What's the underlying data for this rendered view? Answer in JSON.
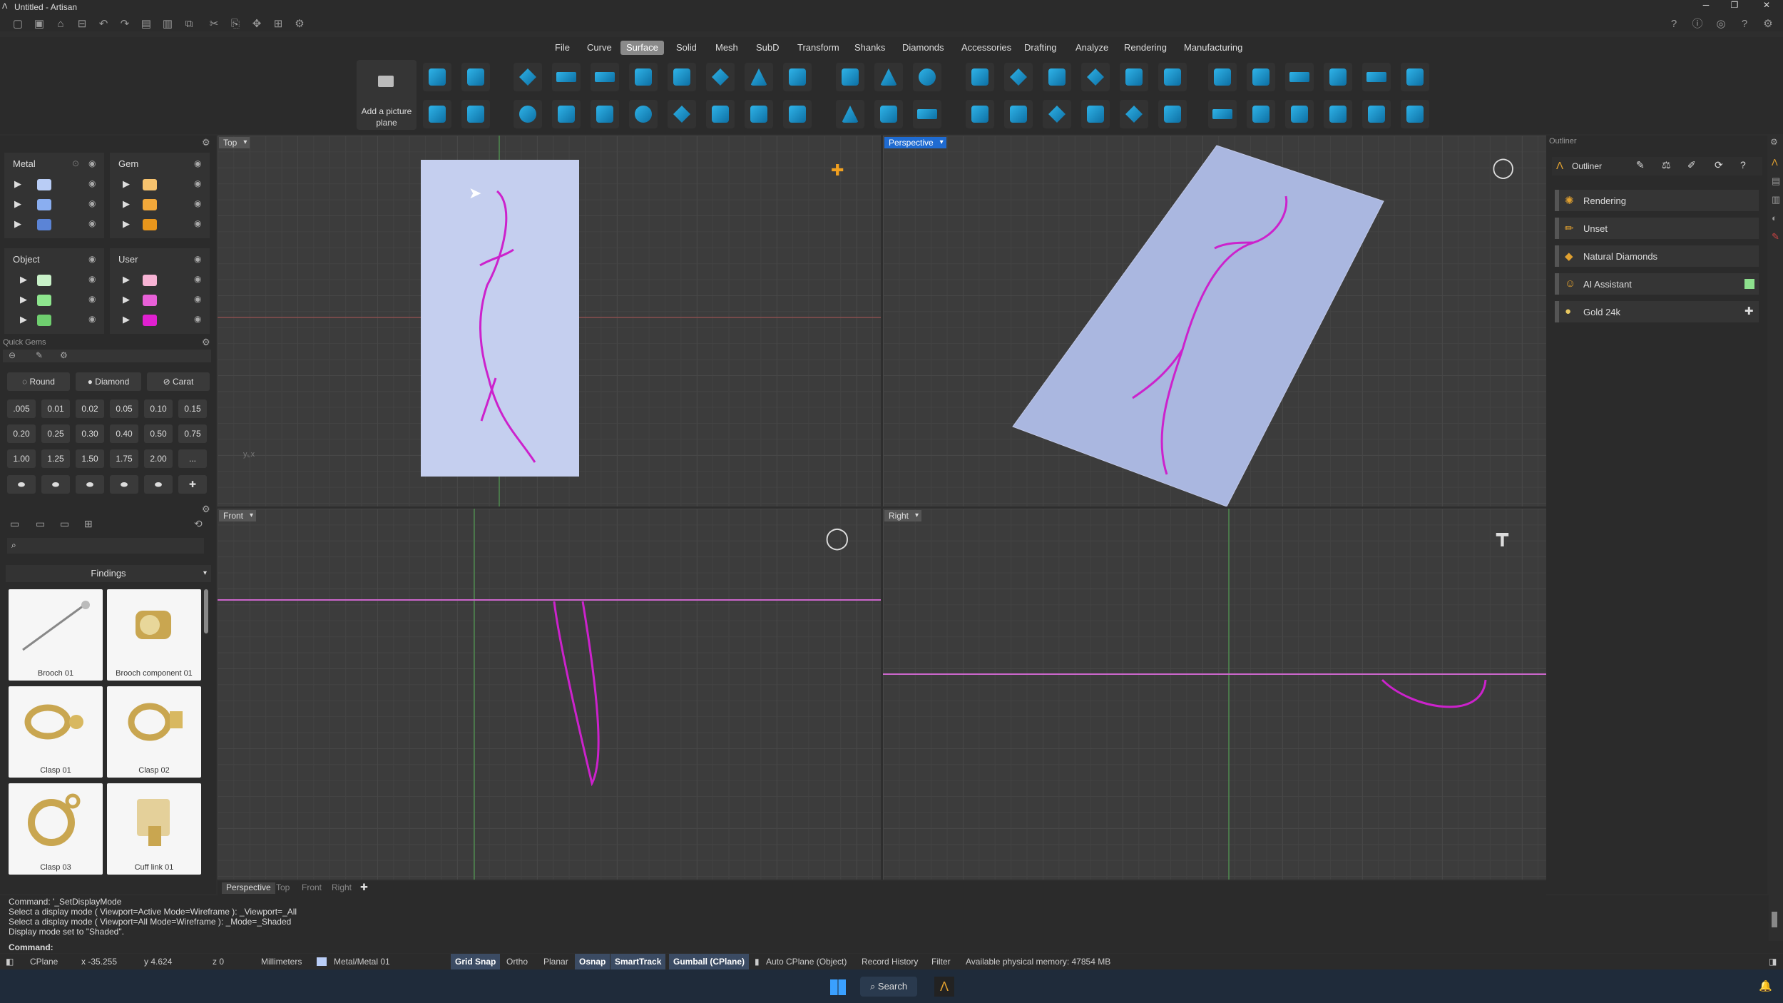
{
  "window": {
    "title": "Untitled - Artisan"
  },
  "menu": [
    "File",
    "Curve",
    "Surface",
    "Solid",
    "Mesh",
    "SubD",
    "Transform",
    "Shanks",
    "Diamonds",
    "Accessories",
    "Drafting",
    "Analyze",
    "Rendering",
    "Manufacturing"
  ],
  "menu_active": "Surface",
  "ribbon": {
    "add_picture_plane": "Add a picture plane"
  },
  "layers": {
    "metal": {
      "title": "Metal"
    },
    "gem": {
      "title": "Gem"
    },
    "object": {
      "title": "Object"
    },
    "user": {
      "title": "User"
    },
    "colors": {
      "metal": [
        "#b9cdf6",
        "#8aaef0",
        "#5b84d6"
      ],
      "gem": [
        "#f7c36e",
        "#f2a83a",
        "#e8961c"
      ],
      "object": [
        "#c9f2c9",
        "#8ee68e",
        "#6fcf6f"
      ],
      "user": [
        "#f7b3d4",
        "#e860d8",
        "#e020d0"
      ]
    }
  },
  "quick_gems": {
    "title": "Quick Gems",
    "shape": "Round",
    "material": "Diamond",
    "unit": "Carat",
    "sizes": [
      ".005",
      "0.01",
      "0.02",
      "0.05",
      "0.10",
      "0.15",
      "0.20",
      "0.25",
      "0.30",
      "0.40",
      "0.50",
      "0.75",
      "1.00",
      "1.25",
      "1.50",
      "1.75",
      "2.00",
      "..."
    ]
  },
  "library": {
    "category": "Findings",
    "items": [
      "Brooch 01",
      "Brooch component 01",
      "Clasp 01",
      "Clasp 02",
      "Clasp 03",
      "Cuff link 01"
    ]
  },
  "viewports": {
    "top": "Top",
    "perspective": "Perspective",
    "front": "Front",
    "right": "Right"
  },
  "viewport_tabs": [
    "Perspective",
    "Top",
    "Front",
    "Right"
  ],
  "outliner": {
    "title": "Outliner",
    "header": "Outliner",
    "items": [
      "Rendering",
      "Unset",
      "Natural Diamonds",
      "AI Assistant",
      "Gold 24k"
    ]
  },
  "command": {
    "history": [
      "Command: '_SetDisplayMode",
      "Select a display mode ( Viewport=Active  Mode=Wireframe ): _Viewport=_All",
      "Select a display mode ( Viewport=All  Mode=Wireframe ): _Mode=_Shaded",
      "Display mode set to \"Shaded\"."
    ],
    "prompt": "Command:"
  },
  "status": {
    "cplane": "CPlane",
    "x": "x -35.255",
    "y": "y 4.624",
    "z": "z 0",
    "units": "Millimeters",
    "layer": "Metal/Metal 01",
    "grid_snap": "Grid Snap",
    "ortho": "Ortho",
    "planar": "Planar",
    "osnap": "Osnap",
    "smarttrack": "SmartTrack",
    "gumball": "Gumball (CPlane)",
    "auto_cplane": "Auto CPlane (Object)",
    "record_history": "Record History",
    "filter": "Filter",
    "memory": "Available physical memory: 47854 MB"
  },
  "taskbar": {
    "search": "Search"
  }
}
